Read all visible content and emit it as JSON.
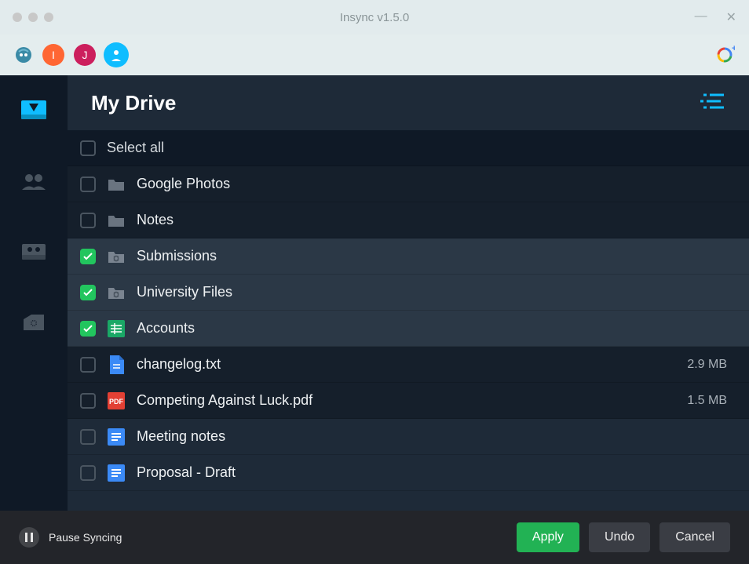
{
  "window": {
    "title": "Insync v1.5.0"
  },
  "accounts": [
    {
      "initial": "I",
      "color": "orange"
    },
    {
      "initial": "J",
      "color": "magenta"
    },
    {
      "initial": "",
      "color": "blue",
      "active": true
    }
  ],
  "header": {
    "title": "My Drive"
  },
  "selectAllLabel": "Select all",
  "files": [
    {
      "name": "Google Photos",
      "type": "folder",
      "checked": false,
      "shade": "dark"
    },
    {
      "name": "Notes",
      "type": "folder",
      "checked": false,
      "shade": "dark"
    },
    {
      "name": "Submissions",
      "type": "folder-sync",
      "checked": true,
      "shade": "light"
    },
    {
      "name": "University Files",
      "type": "folder-sync",
      "checked": true,
      "shade": "light"
    },
    {
      "name": "Accounts",
      "type": "sheet",
      "checked": true,
      "shade": "light"
    },
    {
      "name": "changelog.txt",
      "type": "doc",
      "checked": false,
      "size": "2.9 MB",
      "shade": "dark"
    },
    {
      "name": "Competing Against Luck.pdf",
      "type": "pdf",
      "checked": false,
      "size": "1.5 MB",
      "shade": "dark"
    },
    {
      "name": "Meeting notes",
      "type": "gdoc",
      "checked": false,
      "shade": "mid"
    },
    {
      "name": "Proposal - Draft",
      "type": "gdoc",
      "checked": false,
      "shade": "mid"
    }
  ],
  "footer": {
    "pauseLabel": "Pause Syncing",
    "applyLabel": "Apply",
    "undoLabel": "Undo",
    "cancelLabel": "Cancel"
  },
  "icons": {
    "folder": "folder-icon",
    "doc": "file-icon",
    "pdf": "pdf-icon",
    "sheet": "sheet-icon",
    "gdoc": "gdoc-icon"
  }
}
